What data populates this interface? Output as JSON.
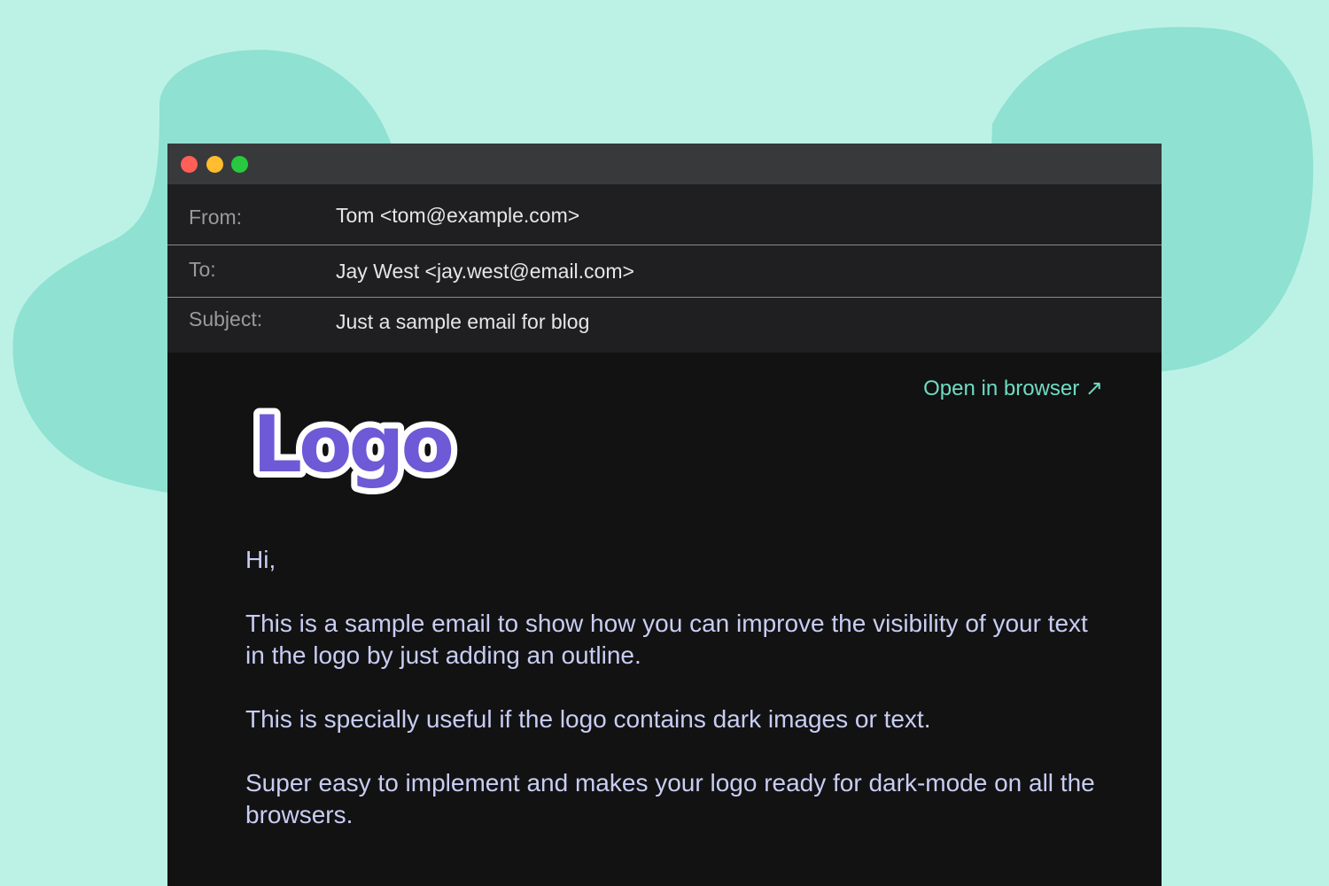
{
  "window": {
    "controls": [
      {
        "name": "close",
        "color": "#ff5f57"
      },
      {
        "name": "minimize",
        "color": "#febc2e"
      },
      {
        "name": "maximize",
        "color": "#28c840"
      }
    ]
  },
  "header": {
    "from": {
      "label": "From:",
      "value": "Tom <tom@example.com>"
    },
    "to": {
      "label": "To:",
      "value": "Jay West <jay.west@email.com>"
    },
    "subject": {
      "label": "Subject:",
      "value": "Just a sample email for blog"
    }
  },
  "content": {
    "open_in_browser": "Open in browser ↗",
    "logo_text": "Logo",
    "logo_color": "#6e59d6",
    "link_color": "#6fdcc3",
    "paragraphs": [
      "Hi,",
      "This is a sample email to show how you can improve the visibility of your text in the logo by just adding an outline.",
      "This is specially useful if the logo contains dark images or text.",
      "Super easy to implement and makes your logo ready for dark-mode on all the browsers."
    ]
  },
  "colors": {
    "background": "#bcf2e5",
    "blob": "#8fe1d2",
    "titlebar": "#38393b",
    "header": "#1f1f21",
    "body": "#121213",
    "text": "#c8cdf2"
  }
}
